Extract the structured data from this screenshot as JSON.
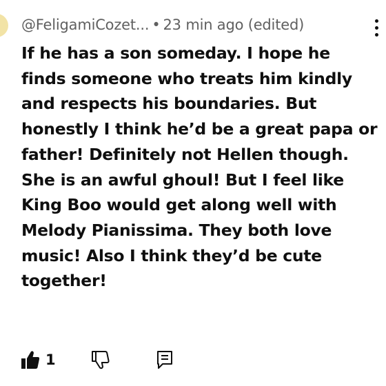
{
  "comment": {
    "author": "@FeligamiCozet...",
    "separator": "•",
    "timestamp": "23 min ago (edited)",
    "text": "If he has a son someday. I hope he finds someone who treats him kindly and respects his boundaries. But honestly I think he’d be a great papa or father! Definitely not Hellen though. She is an awful ghoul! But I feel like King Boo would get along well with Melody Pianissima. They both love music! Also I think they’d be cute together!"
  },
  "actions": {
    "like_count": "1",
    "like_icon": "thumbs-up-filled-icon",
    "dislike_icon": "thumbs-down-outline-icon",
    "reply_icon": "comment-reply-icon",
    "more_icon": "more-vertical-icon"
  },
  "colors": {
    "text_primary": "#0f0f0f",
    "text_secondary": "#606060",
    "avatar": "#f2e3a6",
    "background": "#ffffff"
  }
}
